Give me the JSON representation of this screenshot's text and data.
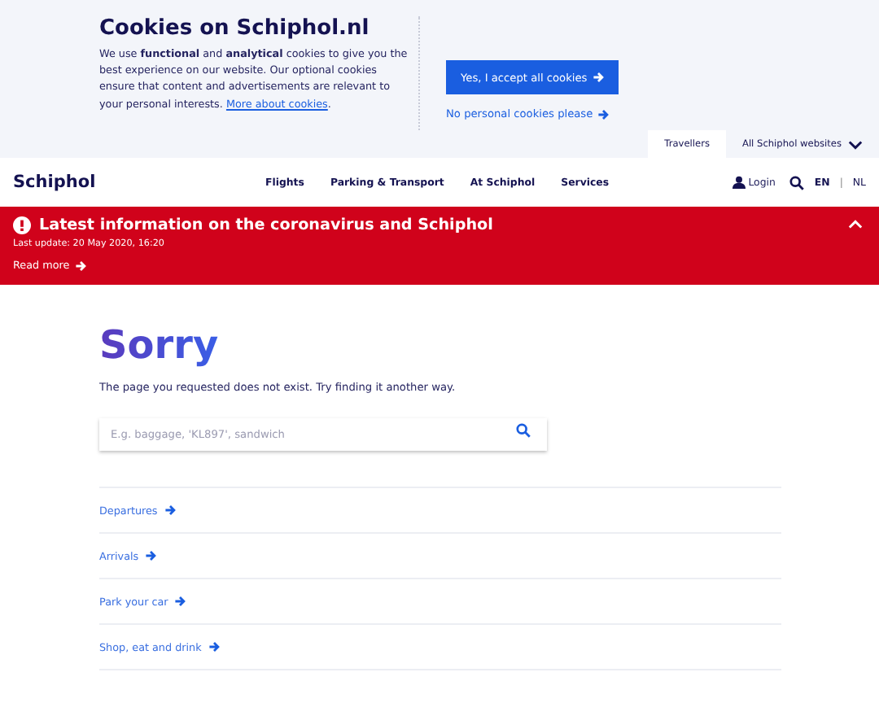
{
  "cookie_banner": {
    "title": "Cookies on Schiphol.nl",
    "text": "We use **functional** and **analytical** cookies to give you the best experience on our website. Our optional cookies ensure that content and advertisements are relevant to your personal interests.",
    "link": "More about cookies",
    "after_link": ".",
    "accept_button": "Yes, I accept all cookies",
    "decline_link": "No personal cookies please"
  },
  "site_tabs": [
    {
      "label": "Travellers",
      "selected": true
    },
    {
      "label": "All Schiphol websites",
      "selected": false
    }
  ],
  "header": {
    "logo": "Schiphol",
    "nav": [
      "Flights",
      "Parking & Transport",
      "At Schiphol",
      "Services"
    ],
    "login": "Login",
    "languages": [
      {
        "label": "EN",
        "selected": true
      },
      {
        "label": "NL",
        "selected": false
      }
    ],
    "lang_separator": "|"
  },
  "alert": {
    "title": "Latest information on the coronavirus and Schiphol",
    "updated": "Last update: 20 May 2020, 16:20",
    "link": "Read more",
    "expanded": true
  },
  "error": {
    "heading": "Sorry",
    "message": "The page you requested does not exist. Try finding it another way.",
    "search_placeholder": "E.g. baggage, 'KL897', sandwich"
  },
  "links": [
    "Departures",
    "Arrivals",
    "Park your car",
    "Shop, eat and drink"
  ]
}
